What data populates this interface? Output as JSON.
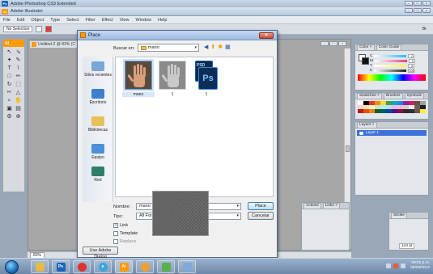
{
  "photoshop_window": {
    "title": "Adobe Photoshop CS3 Extended",
    "badge": "Ps"
  },
  "illustrator_window": {
    "title": "Adobe Illustrator",
    "badge": "Ai"
  },
  "menu": [
    "File",
    "Edit",
    "Object",
    "Type",
    "Select",
    "Filter",
    "Effect",
    "View",
    "Window",
    "Help"
  ],
  "control_bar": {
    "selection": "No Selection",
    "right_label": "Br"
  },
  "document": {
    "tab": "Untitled-2 @ 83% (C",
    "zoom": "83%"
  },
  "toolbox": {
    "header": "Ai",
    "tools": [
      "↖",
      "⇘",
      "✦",
      "✎",
      "T",
      "\\",
      "□",
      "✏",
      "↻",
      "⬚",
      "✂",
      "△",
      "⌕",
      "✋",
      "▣",
      "▤",
      "⚙",
      "⊕"
    ]
  },
  "color_panel": {
    "tabs": [
      "Color ×",
      "Color Guide"
    ],
    "rows": [
      {
        "label": "C",
        "value": "0",
        "color": "#29b6f6"
      },
      {
        "label": "M",
        "value": "0",
        "color": "#ec407a"
      },
      {
        "label": "Y",
        "value": "0",
        "color": "#ffee58"
      },
      {
        "label": "K",
        "value": "100",
        "color": "#222222"
      }
    ]
  },
  "swatches_panel": {
    "tabs": [
      "Swatches ×",
      "Brushes",
      "Symbols"
    ]
  },
  "layers_panel": {
    "tabs": [
      "Layers ×"
    ],
    "layer": "Layer 1"
  },
  "links_panel": {
    "tabs": [
      "Actions",
      "Links ×"
    ]
  },
  "stroke_panel": {
    "label": "Stroke",
    "value": "144 pt"
  },
  "place_dialog": {
    "title": "Place",
    "close": "✕",
    "look_in_label": "Buscar en:",
    "look_in_value": "mano",
    "places": [
      "Sitios recientes",
      "Escritorio",
      "Bibliotecas",
      "Equipo",
      "Red"
    ],
    "files": [
      {
        "name": "mano",
        "selected": true
      },
      {
        "name": "1",
        "selected": false
      },
      {
        "name": "1",
        "selected": false,
        "kind": "psd"
      }
    ],
    "psd_tag": "PSD",
    "psd_letters": "Ps",
    "filename_label": "Nombre:",
    "filename_value": "mano",
    "filetype_label": "Tipo:",
    "filetype_value": "All Formats",
    "place_button": "Place",
    "cancel_button": "Cancelar",
    "link_label": "Link",
    "template_label": "Template",
    "replace_label": "Replace",
    "adobe_dialog_button": "Use Adobe Dialog"
  },
  "taskbar": {
    "time": "09:01 p.m.",
    "date": "09/09/2012"
  }
}
